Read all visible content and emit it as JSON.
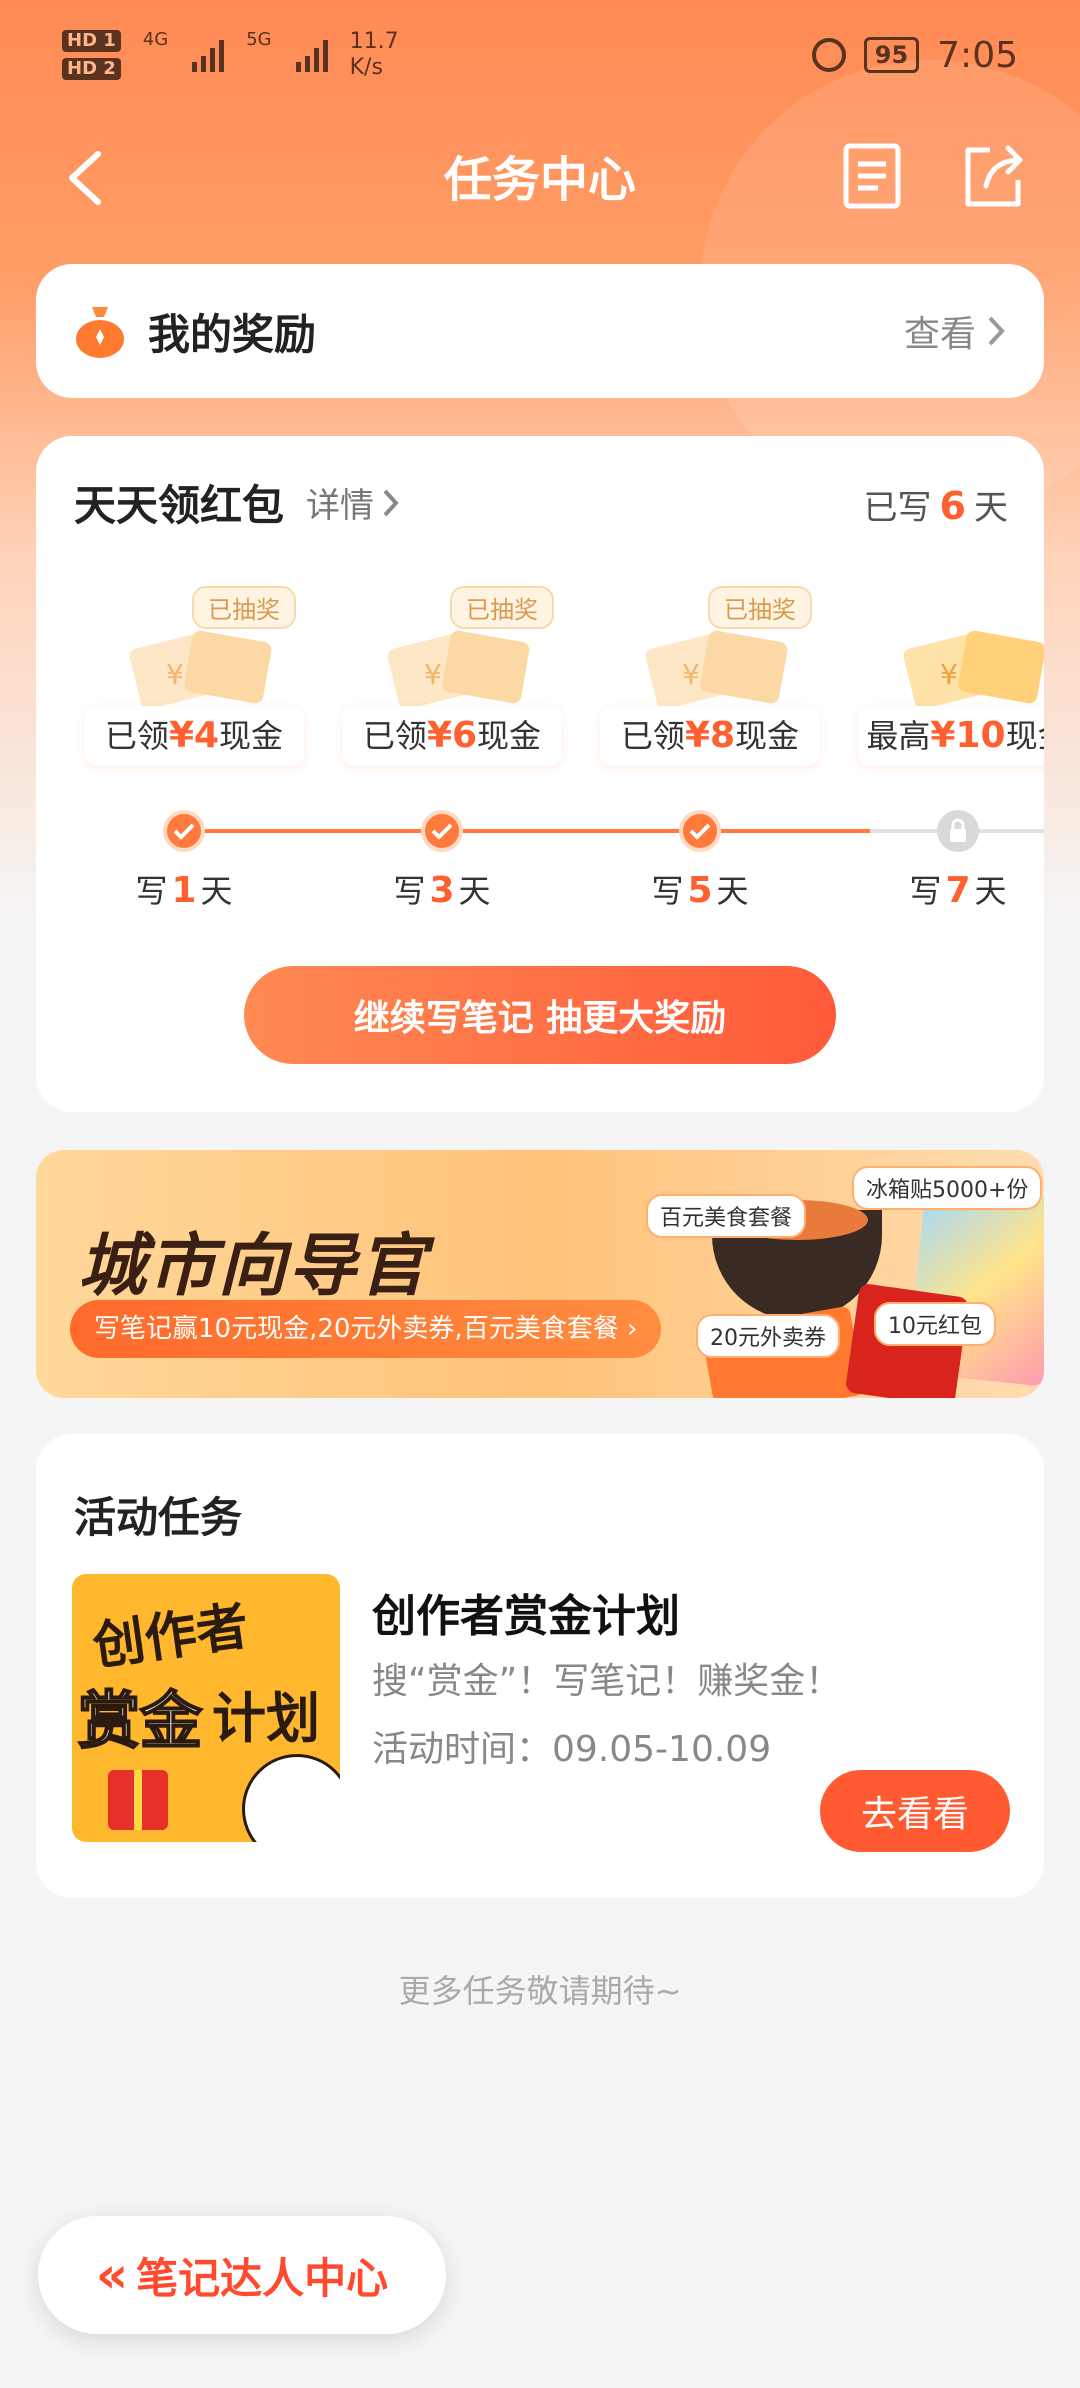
{
  "status_bar": {
    "hd1": "HD 1",
    "hd2": "HD 2",
    "net1": "4G",
    "net2": "5G",
    "speed_value": "11.7",
    "speed_unit": "K/s",
    "battery": "95",
    "time": "7:05"
  },
  "nav": {
    "title": "任务中心"
  },
  "rewards": {
    "title": "我的奖励",
    "view_label": "查看"
  },
  "daily": {
    "title": "天天领红包",
    "detail_label": "详情",
    "written_prefix": "已写",
    "written_days": "6",
    "written_suffix": "天",
    "drawn_tag": "已抽奖",
    "stages": [
      {
        "prefix": "已领",
        "amount": "¥4",
        "suffix": "现金",
        "day_prefix": "写",
        "day": "1",
        "day_suffix": "天",
        "status": "done"
      },
      {
        "prefix": "已领",
        "amount": "¥6",
        "suffix": "现金",
        "day_prefix": "写",
        "day": "3",
        "day_suffix": "天",
        "status": "done"
      },
      {
        "prefix": "已领",
        "amount": "¥8",
        "suffix": "现金",
        "day_prefix": "写",
        "day": "5",
        "day_suffix": "天",
        "status": "done"
      },
      {
        "prefix": "最高",
        "amount": "¥10",
        "suffix": "现金",
        "day_prefix": "写",
        "day": "7",
        "day_suffix": "天",
        "status": "locked"
      }
    ],
    "continue_button": "继续写笔记 抽更大奖励"
  },
  "banner": {
    "title": "城市向导官",
    "strip": "写笔记赢10元现金,20元外卖券,百元美食套餐 ›",
    "chips": {
      "food": "百元美食套餐",
      "sticker": "冰箱贴5000+份",
      "takeout": "20元外卖券",
      "redpack": "10元红包"
    }
  },
  "activity": {
    "section_title": "活动任务",
    "thumb_line1": "创作者",
    "thumb_line2": "赏金",
    "thumb_line3": "计划",
    "name": "创作者赏金计划",
    "desc": "搜“赏金”！写笔记！赚奖金！",
    "time": "活动时间：09.05-10.09",
    "go_button": "去看看"
  },
  "more_text": "更多任务敬请期待~",
  "bottom_fab": {
    "icon": "«",
    "label": "笔记达人中心"
  },
  "colors": {
    "accent": "#ff5a32",
    "header_gradient_top": "#ff8a54"
  }
}
